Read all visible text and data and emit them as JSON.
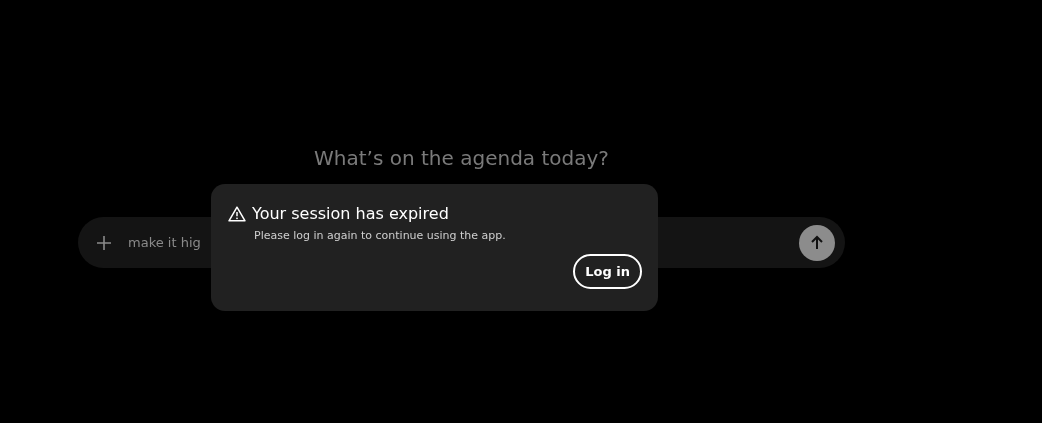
{
  "heading": "What’s on the agenda today?",
  "composer": {
    "value": "make it hig"
  },
  "dialog": {
    "title": "Your session has expired",
    "message": "Please log in again to continue using the app.",
    "button": "Log in"
  }
}
